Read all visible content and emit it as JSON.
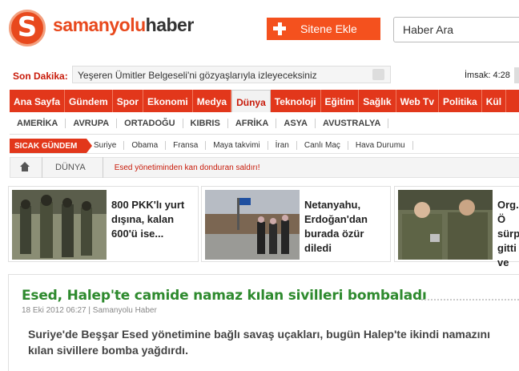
{
  "brand": {
    "logo_glyph": "S",
    "name_part1": "samanyolu",
    "name_part2": "haber",
    "accent": "#e8491d"
  },
  "header": {
    "add_site_label": "Sitene Ekle",
    "search_placeholder": "Haber Ara"
  },
  "breaking": {
    "label": "Son Dakika:",
    "headline": "Yeşeren Ümitler Belgeseli'ni gözyaşlarıyla izleyeceksiniz"
  },
  "prayer": {
    "text": "İmsak: 4:28"
  },
  "main_nav": [
    {
      "label": "Ana Sayfa"
    },
    {
      "label": "Gündem"
    },
    {
      "label": "Spor"
    },
    {
      "label": "Ekonomi"
    },
    {
      "label": "Medya"
    },
    {
      "label": "Dünya",
      "active": true
    },
    {
      "label": "Teknoloji"
    },
    {
      "label": "Eğitim"
    },
    {
      "label": "Sağlık"
    },
    {
      "label": "Web Tv"
    },
    {
      "label": "Politika"
    },
    {
      "label": "Kül"
    }
  ],
  "sub_nav": [
    "AMERİKA",
    "AVRUPA",
    "ORTADOĞU",
    "KIBRIS",
    "AFRİKA",
    "ASYA",
    "AVUSTRALYA"
  ],
  "hot": {
    "label": "SICAK GÜNDEM",
    "items": [
      "Suriye",
      "Obama",
      "Fransa",
      "Maya takvimi",
      "İran",
      "Canlı Maç",
      "Hava Durumu"
    ]
  },
  "crumb": {
    "section": "DÜNYA",
    "title": "Esed yönetiminden kan donduran saldırı!"
  },
  "cards": [
    {
      "title": "800 PKK'lı yurt dışına, kalan 600'ü ise..."
    },
    {
      "title": "Netanyahu, Erdoğan'dan burada özür diledi"
    },
    {
      "title": "Org. Ö sürpri gitti ve"
    }
  ],
  "article": {
    "title": "Esed, Halep'te camide namaz kılan sivilleri bombaladı",
    "meta": "18 Eki 2012 06:27 | Samanyolu Haber",
    "lead": "Suriye'de Beşşar Esed yönetimine bağlı savaş uçakları, bugün Halep'te ikindi namazını kılan sivillere bomba yağdırdı."
  }
}
